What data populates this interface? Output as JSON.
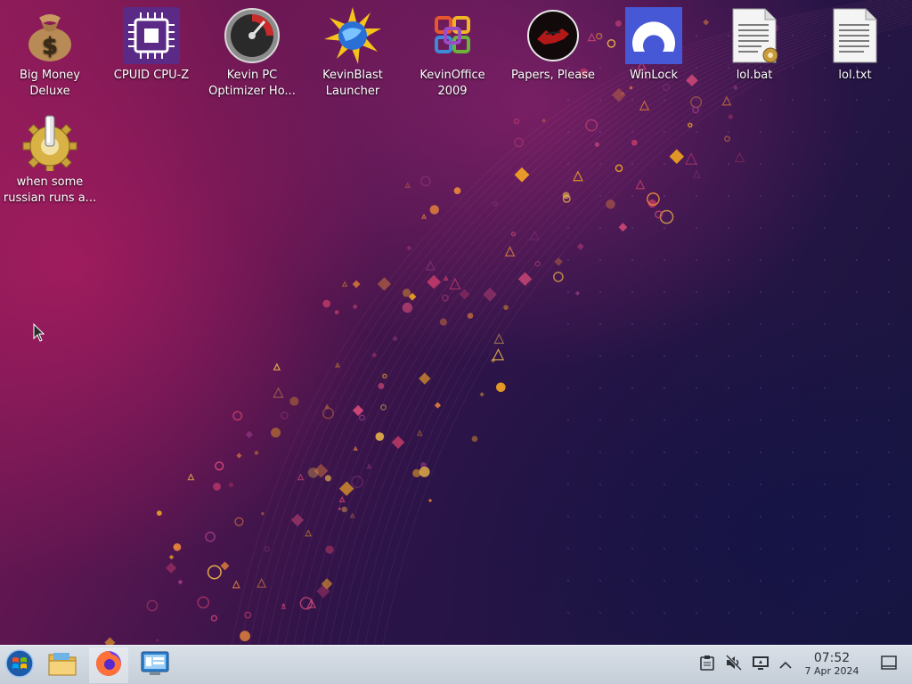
{
  "desktop": {
    "icons": [
      {
        "label": "Big Money\nDeluxe",
        "icon": "money-bag-icon"
      },
      {
        "label": "CPUID CPU-Z",
        "icon": "cpu-chip-icon"
      },
      {
        "label": "Kevin PC\nOptimizer Ho...",
        "icon": "speedometer-icon"
      },
      {
        "label": "KevinBlast\nLauncher",
        "icon": "globe-starburst-icon"
      },
      {
        "label": "KevinOffice\n2009",
        "icon": "office-logo-icon"
      },
      {
        "label": "Papers, Please",
        "icon": "papers-please-seal-icon"
      },
      {
        "label": "WinLock",
        "icon": "winlock-icon"
      },
      {
        "label": "lol.bat",
        "icon": "batch-file-icon"
      },
      {
        "label": "lol.txt",
        "icon": "text-file-icon"
      },
      {
        "label": "when some\nrussian runs a...",
        "icon": "gear-icon"
      }
    ]
  },
  "taskbar": {
    "buttons": [
      {
        "name": "start-menu",
        "icon": "start-orb-icon"
      },
      {
        "name": "file-manager",
        "icon": "folder-icon"
      },
      {
        "name": "firefox",
        "icon": "firefox-icon"
      },
      {
        "name": "system-settings",
        "icon": "control-panel-icon"
      }
    ],
    "tray": [
      {
        "name": "clipboard",
        "icon": "clipboard-icon"
      },
      {
        "name": "volume-muted",
        "icon": "speaker-muted-icon"
      },
      {
        "name": "network",
        "icon": "monitor-network-icon"
      },
      {
        "name": "show-hidden",
        "icon": "chevron-up-icon"
      }
    ],
    "clock": {
      "time": "07:52",
      "date": "7 Apr 2024"
    },
    "show_desktop": {
      "icon": "show-desktop-icon"
    }
  },
  "colors": {
    "taskbar_bg": "#c9d1db",
    "wallpaper_magenta": "#8a1b58",
    "wallpaper_navy": "#17163d",
    "accent_orange": "#f5a623"
  }
}
